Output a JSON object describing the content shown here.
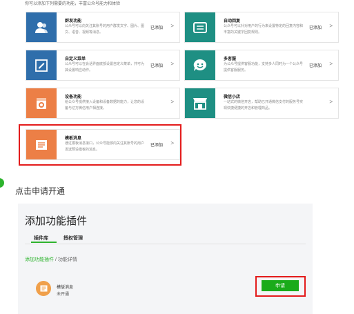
{
  "intro": "你可以添加下列需要的功能，丰富公众号能力和体验",
  "colors": {
    "blue": "#2f6eab",
    "teal": "#1e8f83",
    "orange": "#ec7f46",
    "green": "#2db32d",
    "red": "#e31b1b"
  },
  "cards": [
    {
      "title": "群发功能",
      "desc": "公众号可以向关注其账号的用户群发文字、图片、图文、语音、视频等消息。",
      "status": "已添加",
      "icon": "users-icon"
    },
    {
      "title": "自动回复",
      "desc": "公众号可以针对用户的行为来设置特定的回复内容和丰富的关键字回复规则。",
      "status": "已添加",
      "icon": "message-box-icon"
    },
    {
      "title": "自定义菜单",
      "desc": "公众号可以在会话界面底部设置自定义菜单，并可为其设置响应动作。",
      "status": "已添加",
      "icon": "edit-icon"
    },
    {
      "title": "多客服",
      "desc": "为公众号提供客服功能，支持多人同时为一个公众号提供客服服务。",
      "status": "已添加",
      "icon": "smiley-icon"
    },
    {
      "title": "设备功能",
      "desc": "给公众号提供接入设备和设备数据的能力，让您的设备与亿万微信用户相连接。",
      "status": "",
      "icon": "washing-machine-icon"
    },
    {
      "title": "微信小店",
      "desc": "一站式的微信开店，帮助已开通微信支付的服务号实现快捷便捷的开店和管理商品。",
      "status": "",
      "icon": "store-icon"
    },
    {
      "title": "模板消息",
      "desc": "通过模板消息接口，公众号能够向关注其账号的用户发送预设模板的消息。",
      "status": "已添加",
      "icon": "template-icon"
    }
  ],
  "step": {
    "text": "点击申请开通"
  },
  "panel": {
    "title": "添加功能插件",
    "tabs": [
      "插件库",
      "授权管理"
    ],
    "breadcrumb": {
      "link": "添加功能插件",
      "sep": "/",
      "current": "功能详情"
    },
    "plugin": {
      "name": "模版消息",
      "status": "未开通",
      "icon": "template-icon"
    },
    "apply_label": "申请"
  }
}
